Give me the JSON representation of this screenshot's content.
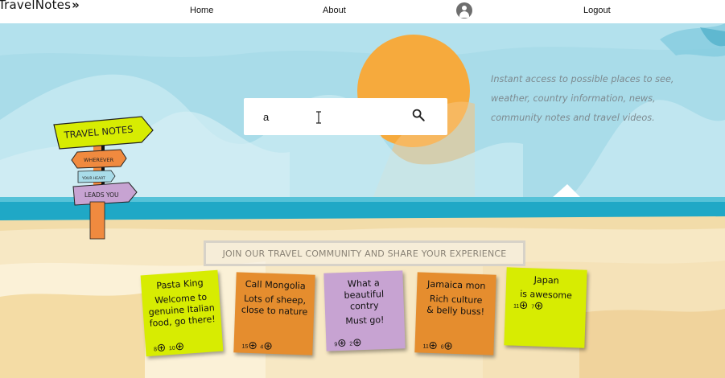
{
  "nav": {
    "brand": "TravelNotes",
    "brand_chevron": "»",
    "links": {
      "home": "Home",
      "about": "About",
      "logout": "Logout"
    },
    "profile_icon": "account-circle-icon"
  },
  "hero": {
    "tagline_lines": [
      "Instant access to possible places to see,",
      "weather, country information, news,",
      "community notes and travel videos."
    ],
    "search": {
      "value": "a",
      "icon": "search-icon"
    },
    "signpost": {
      "top": "TRAVEL NOTES",
      "middle": "WHEREVER",
      "small": "YOUR HEART",
      "bottom": "LEADS YOU"
    }
  },
  "community": {
    "banner": "JOIN OUR TRAVEL COMMUNITY AND SHARE YOUR EXPERIENCE",
    "notes": [
      {
        "title": "Pasta King",
        "text": "Welcome to genuine Italian food, go there!",
        "up": "8",
        "down": "10",
        "color": "#d7ec02"
      },
      {
        "title": "Call Mongolia",
        "text": "Lots of sheep, close to nature",
        "up": "15",
        "down": "4",
        "color": "#e58d2e"
      },
      {
        "title": "What a beautiful contry",
        "text": "Must go!",
        "up": "9",
        "down": "2",
        "color": "#c7a3d2"
      },
      {
        "title": "Jamaica mon",
        "text": "Rich culture & belly buss!",
        "up": "11",
        "down": "6",
        "color": "#e58d2e"
      },
      {
        "title": "Japan",
        "text": "is awesome",
        "up": "11",
        "down": "7",
        "color": "#d7ec02"
      }
    ]
  },
  "colors": {
    "sky": "#a7dbe8",
    "sun": "#f5a93b",
    "sea": "#1fa9c7",
    "sand": "#f1d9a4",
    "note_yellow": "#d7ec02",
    "note_orange": "#e58d2e",
    "note_purple": "#c7a3d2"
  }
}
